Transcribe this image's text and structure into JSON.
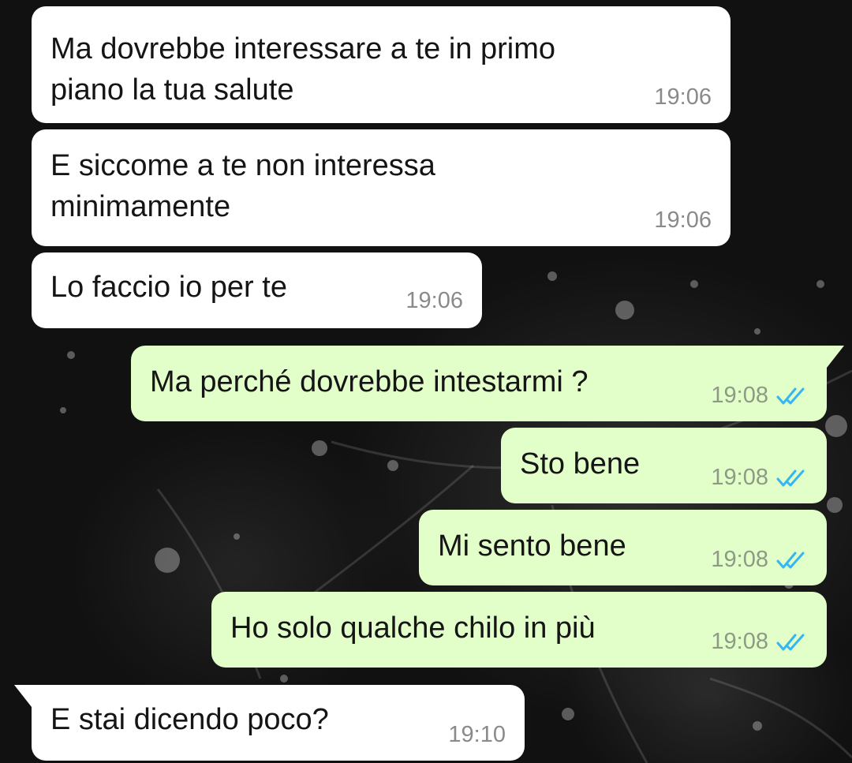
{
  "messages": [
    {
      "text_lines": [
        "Ma dovrebbe interessare a te in primo",
        "piano la tua salute"
      ],
      "time": "19:06",
      "direction": "incoming"
    },
    {
      "text_lines": [
        "E siccome a te non interessa",
        "minimamente"
      ],
      "time": "19:06",
      "direction": "incoming"
    },
    {
      "text": "Lo faccio io per te",
      "time": "19:06",
      "direction": "incoming"
    },
    {
      "text": "Ma perché dovrebbe intestarmi ?",
      "time": "19:08",
      "direction": "outgoing",
      "status": "read"
    },
    {
      "text": "Sto bene",
      "time": "19:08",
      "direction": "outgoing",
      "status": "read"
    },
    {
      "text": "Mi sento bene",
      "time": "19:08",
      "direction": "outgoing",
      "status": "read"
    },
    {
      "text": "Ho solo qualche chilo in più",
      "time": "19:08",
      "direction": "outgoing",
      "status": "read"
    },
    {
      "text": "E stai dicendo poco?",
      "time": "19:10",
      "direction": "incoming"
    }
  ],
  "colors": {
    "incoming_bubble": "#ffffff",
    "outgoing_bubble": "#e2fec9",
    "read_tick": "#34b7f1",
    "wallpaper": "#111111"
  },
  "icons": {
    "read_status": "double-check-icon"
  }
}
